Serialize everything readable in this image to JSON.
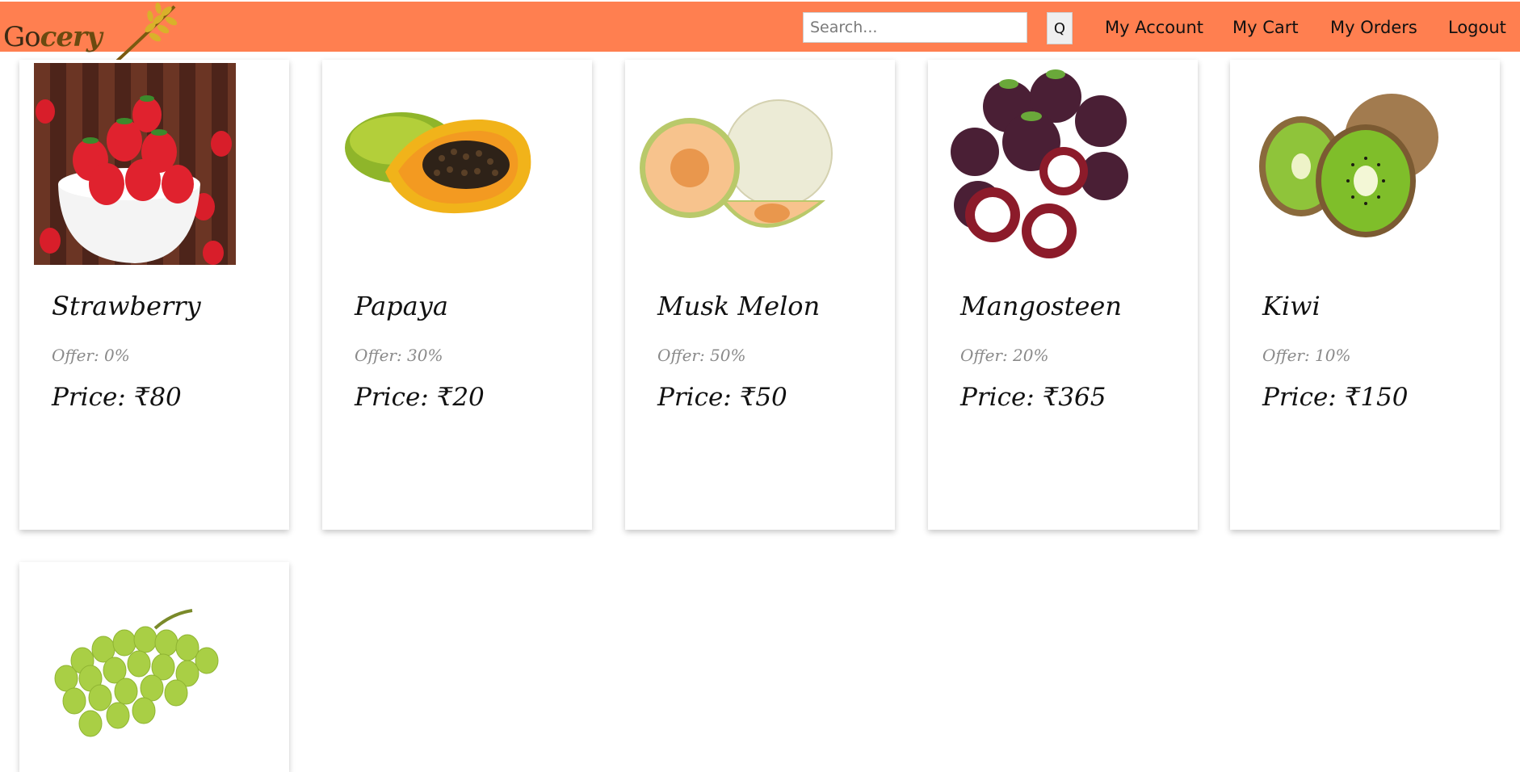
{
  "brand": {
    "logo_go": "Go",
    "logo_cery": "cery"
  },
  "search": {
    "placeholder": "Search...",
    "button_label": "Q"
  },
  "nav": {
    "my_account": "My Account",
    "my_cart": "My Cart",
    "my_orders": "My Orders",
    "logout": "Logout"
  },
  "colors": {
    "navbar": "#ff7f50",
    "offer_text": "#8a8a8a"
  },
  "products": [
    {
      "name": "Strawberry",
      "offer": "Offer: 0%",
      "price": "Price: ₹80",
      "icon": "strawberry-image"
    },
    {
      "name": "Papaya",
      "offer": "Offer: 30%",
      "price": "Price: ₹20",
      "icon": "papaya-image"
    },
    {
      "name": "Musk Melon",
      "offer": "Offer: 50%",
      "price": "Price: ₹50",
      "icon": "musk-melon-image"
    },
    {
      "name": "Mangosteen",
      "offer": "Offer: 20%",
      "price": "Price: ₹365",
      "icon": "mangosteen-image"
    },
    {
      "name": "Kiwi",
      "offer": "Offer: 10%",
      "price": "Price: ₹150",
      "icon": "kiwi-image"
    },
    {
      "name": "",
      "offer": "",
      "price": "",
      "icon": "grapes-image"
    }
  ]
}
